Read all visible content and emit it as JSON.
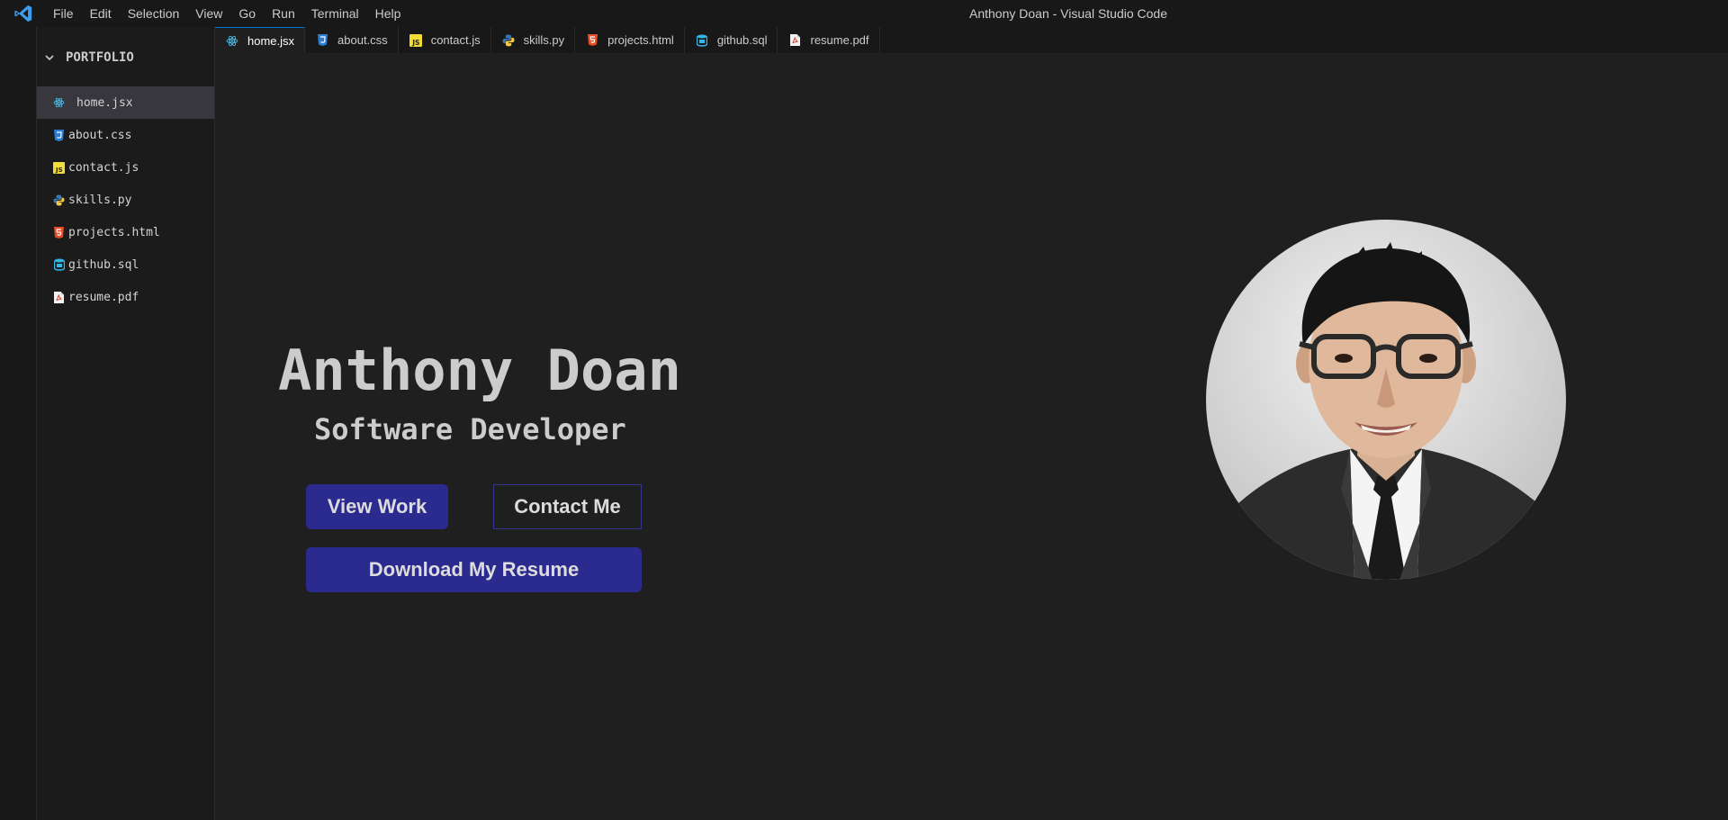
{
  "window": {
    "title": "Anthony Doan - Visual Studio Code"
  },
  "menu": [
    "File",
    "Edit",
    "Selection",
    "View",
    "Go",
    "Run",
    "Terminal",
    "Help"
  ],
  "sidebar": {
    "header": "PORTFOLIO",
    "files": [
      {
        "name": "home.jsx",
        "icon": "react-icon",
        "active": true
      },
      {
        "name": "about.css",
        "icon": "css-icon"
      },
      {
        "name": "contact.js",
        "icon": "js-icon"
      },
      {
        "name": "skills.py",
        "icon": "python-icon"
      },
      {
        "name": "projects.html",
        "icon": "html-icon"
      },
      {
        "name": "github.sql",
        "icon": "database-icon"
      },
      {
        "name": "resume.pdf",
        "icon": "pdf-icon"
      }
    ]
  },
  "tabs": [
    {
      "name": "home.jsx",
      "icon": "react-icon",
      "active": true
    },
    {
      "name": "about.css",
      "icon": "css-icon"
    },
    {
      "name": "contact.js",
      "icon": "js-icon"
    },
    {
      "name": "skills.py",
      "icon": "python-icon"
    },
    {
      "name": "projects.html",
      "icon": "html-icon"
    },
    {
      "name": "github.sql",
      "icon": "database-icon"
    },
    {
      "name": "resume.pdf",
      "icon": "pdf-icon"
    }
  ],
  "hero": {
    "name": "Anthony Doan",
    "role": "Software Developer",
    "view_work": "View Work",
    "contact_me": "Contact Me",
    "download_resume": "Download My Resume"
  },
  "colors": {
    "accent": "#2b2b8f",
    "background": "#1f1f1f",
    "vscode_blue": "#0078d4"
  }
}
